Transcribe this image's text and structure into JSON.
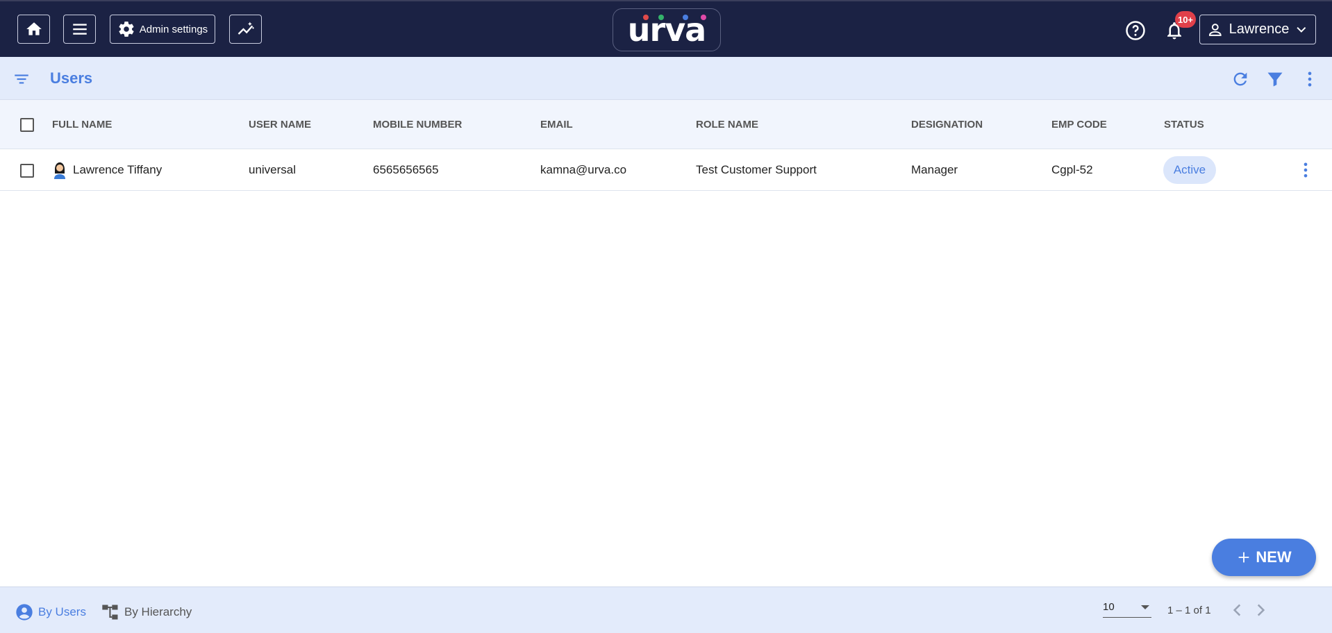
{
  "topbar": {
    "admin_settings_label": "Admin settings",
    "logo_text": "urva",
    "notification_badge": "10+",
    "user_name": "Lawrence",
    "colors": {
      "background": "#1b2244",
      "badge": "#e0404a"
    }
  },
  "subbar": {
    "title": "Users"
  },
  "table": {
    "columns": [
      "FULL NAME",
      "USER NAME",
      "MOBILE NUMBER",
      "EMAIL",
      "ROLE NAME",
      "DESIGNATION",
      "EMP CODE",
      "STATUS"
    ],
    "rows": [
      {
        "full_name": "Lawrence Tiffany",
        "user_name": "universal",
        "mobile": "6565656565",
        "email": "kamna@urva.co",
        "role": "Test Customer Support",
        "designation": "Manager",
        "emp_code": "Cgpl-52",
        "status": "Active"
      }
    ]
  },
  "fab": {
    "label": "NEW"
  },
  "footer": {
    "tab_users": "By Users",
    "tab_hierarchy": "By Hierarchy",
    "page_size": "10",
    "page_range": "1 – 1 of 1"
  },
  "accent_color": "#4a7ee0"
}
